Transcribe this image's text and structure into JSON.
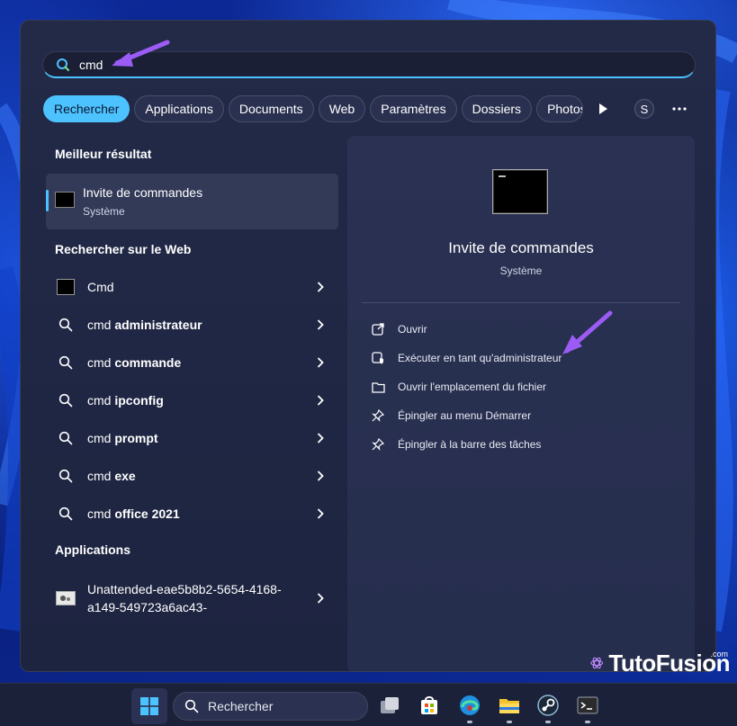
{
  "search": {
    "query": "cmd"
  },
  "tabs": [
    {
      "label": "Rechercher",
      "active": true
    },
    {
      "label": "Applications"
    },
    {
      "label": "Documents"
    },
    {
      "label": "Web"
    },
    {
      "label": "Paramètres"
    },
    {
      "label": "Dossiers"
    },
    {
      "label": "Photos"
    }
  ],
  "header": {
    "avatar_letter": "S"
  },
  "best_match": {
    "section_title": "Meilleur résultat",
    "title": "Invite de commandes",
    "subtitle": "Système"
  },
  "web": {
    "section_title": "Rechercher sur le Web",
    "items": [
      {
        "prefix": "",
        "bold": "Cmd"
      },
      {
        "prefix": "cmd ",
        "bold": "administrateur"
      },
      {
        "prefix": "cmd ",
        "bold": "commande"
      },
      {
        "prefix": "cmd ",
        "bold": "ipconfig"
      },
      {
        "prefix": "cmd ",
        "bold": "prompt"
      },
      {
        "prefix": "cmd ",
        "bold": "exe"
      },
      {
        "prefix": "cmd ",
        "bold": "office 2021"
      }
    ]
  },
  "apps": {
    "section_title": "Applications",
    "item_line1": "Unattended-eae5b8b2-5654-4168-",
    "item_line2": "a149-549723a6ac43-"
  },
  "preview": {
    "title": "Invite de commandes",
    "subtitle": "Système",
    "actions": [
      {
        "label": "Ouvrir",
        "icon": "open-external-icon"
      },
      {
        "label": "Exécuter en tant qu'administrateur",
        "icon": "shield-admin-icon"
      },
      {
        "label": "Ouvrir l'emplacement du fichier",
        "icon": "folder-icon"
      },
      {
        "label": "Épingler au menu Démarrer",
        "icon": "pin-icon"
      },
      {
        "label": "Épingler à la barre des tâches",
        "icon": "pin-icon"
      }
    ]
  },
  "taskbar": {
    "search_label": "Rechercher"
  },
  "logo": {
    "brand": "TutoFusion",
    "suffix": ".com"
  },
  "colors": {
    "accent": "#4cc2ff",
    "annotation": "#9b5cf6",
    "panel": "#222a48"
  }
}
